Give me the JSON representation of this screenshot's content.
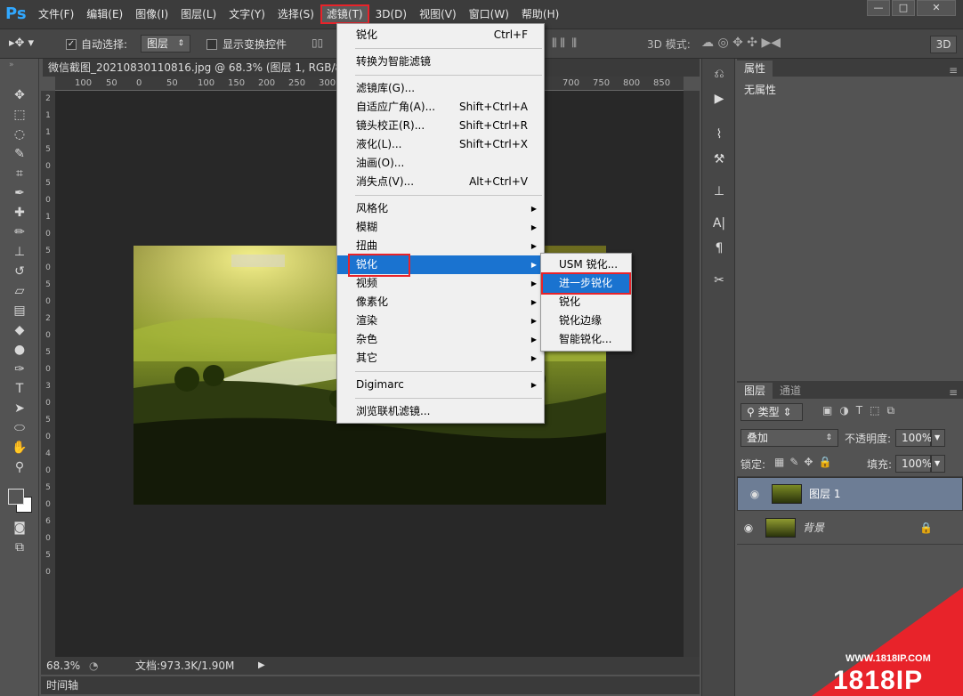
{
  "app": {
    "logo": "Ps"
  },
  "menubar": {
    "items": [
      "文件(F)",
      "编辑(E)",
      "图像(I)",
      "图层(L)",
      "文字(Y)",
      "选择(S)",
      "滤镜(T)",
      "3D(D)",
      "视图(V)",
      "窗口(W)",
      "帮助(H)"
    ],
    "active_index": 6
  },
  "window_buttons": [
    "—",
    "□",
    "✕"
  ],
  "options": {
    "auto_select_label": "自动选择:",
    "auto_select_value": "图层",
    "show_transform_label": "显示变换控件",
    "mode3d_label": "3D 模式:",
    "badge_3d": "3D"
  },
  "document": {
    "tab_title": "微信截图_20210830110816.jpg @ 68.3% (图层 1, RGB/8#) *",
    "ruler_top": [
      "100",
      "50",
      "0",
      "50",
      "100",
      "150",
      "200",
      "250",
      "300",
      "700",
      "750",
      "800",
      "850"
    ],
    "ruler_left": [
      "2",
      "1",
      "1",
      "5",
      "0",
      "5",
      "0",
      "1",
      "0",
      "5",
      "0",
      "5",
      "0",
      "2",
      "0",
      "5",
      "0",
      "3",
      "0",
      "5",
      "0",
      "4",
      "0",
      "5",
      "0",
      "6",
      "0",
      "5",
      "0"
    ]
  },
  "status": {
    "zoom": "68.3%",
    "doc_info": "文档:973.3K/1.90M"
  },
  "timeline": {
    "label": "时间轴"
  },
  "filter_menu": {
    "groups": [
      [
        {
          "label": "锐化",
          "shortcut": "Ctrl+F"
        }
      ],
      [
        {
          "label": "转换为智能滤镜"
        }
      ],
      [
        {
          "label": "滤镜库(G)..."
        },
        {
          "label": "自适应广角(A)...",
          "shortcut": "Shift+Ctrl+A"
        },
        {
          "label": "镜头校正(R)...",
          "shortcut": "Shift+Ctrl+R"
        },
        {
          "label": "液化(L)...",
          "shortcut": "Shift+Ctrl+X"
        },
        {
          "label": "油画(O)..."
        },
        {
          "label": "消失点(V)...",
          "shortcut": "Alt+Ctrl+V"
        }
      ],
      [
        {
          "label": "风格化",
          "submenu": true
        },
        {
          "label": "模糊",
          "submenu": true
        },
        {
          "label": "扭曲",
          "submenu": true
        },
        {
          "label": "锐化",
          "submenu": true,
          "highlighted": true
        },
        {
          "label": "视频",
          "submenu": true
        },
        {
          "label": "像素化",
          "submenu": true
        },
        {
          "label": "渲染",
          "submenu": true
        },
        {
          "label": "杂色",
          "submenu": true
        },
        {
          "label": "其它",
          "submenu": true
        }
      ],
      [
        {
          "label": "Digimarc",
          "submenu": true
        }
      ],
      [
        {
          "label": "浏览联机滤镜..."
        }
      ]
    ]
  },
  "sharpen_submenu": {
    "items": [
      "USM 锐化...",
      "进一步锐化",
      "锐化",
      "锐化边缘",
      "智能锐化..."
    ],
    "highlighted_index": 1
  },
  "properties_panel": {
    "tab": "属性",
    "empty_text": "无属性"
  },
  "layers_panel": {
    "tabs": [
      "图层",
      "通道"
    ],
    "filter_kind": "类型",
    "blend_mode": "叠加",
    "opacity_label": "不透明度:",
    "opacity_value": "100%",
    "lock_label": "锁定:",
    "fill_label": "填充:",
    "fill_value": "100%",
    "layers": [
      {
        "name": "图层 1",
        "selected": true
      },
      {
        "name": "背景",
        "locked": true
      }
    ]
  },
  "watermark": {
    "url": "WWW.1818IP.COM",
    "brand": "1818IP"
  },
  "colors": {
    "menu_highlight": "#1a73d0",
    "annotation_red": "#e8232a",
    "app_bg": "#535353"
  }
}
